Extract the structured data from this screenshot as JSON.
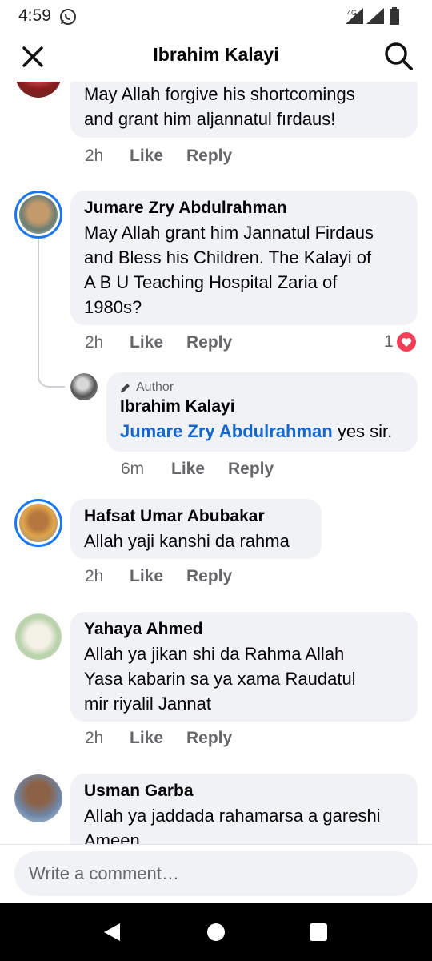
{
  "status_bar": {
    "time": "4:59",
    "network_label": "4G",
    "icons": [
      "whatsapp-icon",
      "signal-4g-icon",
      "signal-icon",
      "battery-icon"
    ]
  },
  "header": {
    "title": "Ibrahim Kalayi",
    "close_icon": "close-icon",
    "search_icon": "search-icon"
  },
  "comments": [
    {
      "id": "c0",
      "name": "",
      "text_lines": [
        "May Allah forgive his shortcomings",
        "and grant him aljannatul fırdaus!"
      ],
      "time": "2h",
      "like": "Like",
      "reply": "Reply"
    },
    {
      "id": "c1",
      "name": "Jumare Zry Abdulrahman",
      "text_lines": [
        "May Allah grant him Jannatul Firdaus",
        "and Bless his Children. The Kalayi of",
        "A B U Teaching Hospital Zaria of",
        "1980s?"
      ],
      "time": "2h",
      "like": "Like",
      "reply": "Reply",
      "reaction_count": "1",
      "reaction_icon": "heart-icon"
    },
    {
      "id": "c1r1",
      "author_tag": "Author",
      "name": "Ibrahim Kalayi",
      "mention": "Jumare Zry Abdulrahman",
      "text": " yes sir.",
      "time": "6m",
      "like": "Like",
      "reply": "Reply"
    },
    {
      "id": "c2",
      "name": "Hafsat Umar Abubakar",
      "text_lines": [
        "Allah yaji kanshi da rahma"
      ],
      "time": "2h",
      "like": "Like",
      "reply": "Reply"
    },
    {
      "id": "c3",
      "name": "Yahaya Ahmed",
      "text_lines": [
        "Allah ya jikan shi da Rahma Allah",
        "Yasa kabarin sa ya xama Raudatul",
        "mir riyalil Jannat"
      ],
      "time": "2h",
      "like": "Like",
      "reply": "Reply"
    },
    {
      "id": "c4",
      "name": "Usman Garba",
      "text_lines": [
        "Allah ya jaddada rahamarsa a gareshi",
        "Ameen"
      ]
    }
  ],
  "composer": {
    "placeholder": "Write a comment…"
  },
  "colors": {
    "accent": "#1877f2",
    "bubble": "#f0f2f5",
    "secondary_text": "#65676b",
    "heart": "#f33e58"
  },
  "navbar": {
    "icons": [
      "back-icon",
      "home-icon",
      "recents-icon"
    ]
  }
}
